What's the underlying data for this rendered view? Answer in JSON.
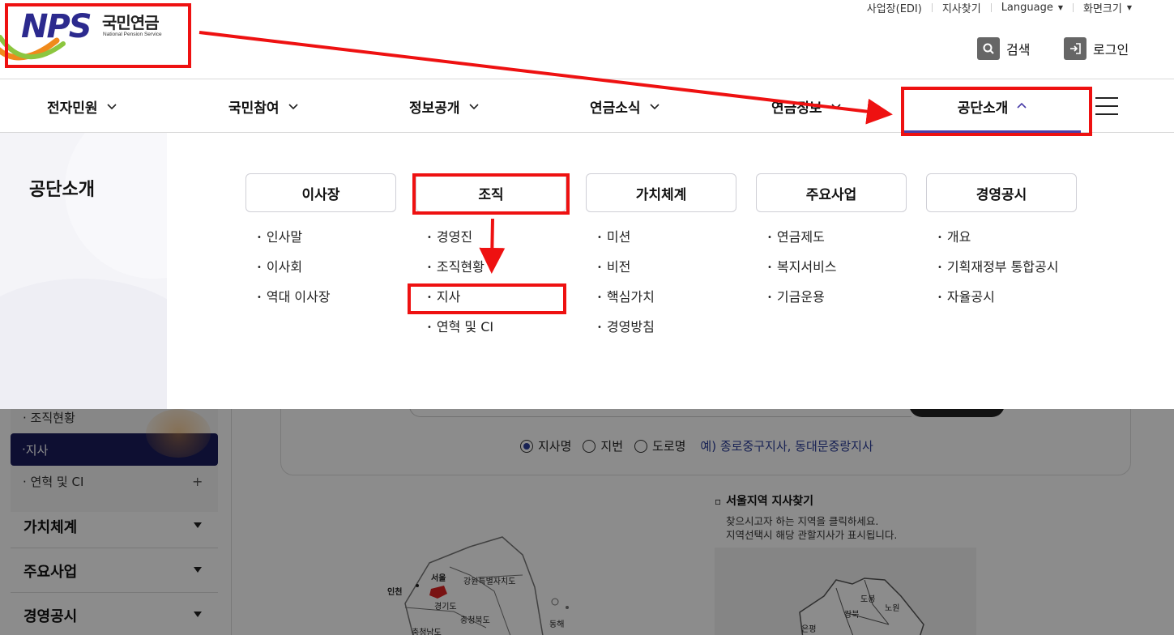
{
  "logo": {
    "text": "NPS",
    "kr": "국민연금",
    "en": "National Pension Service"
  },
  "util": {
    "edi": "사업장(EDI)",
    "branch_find": "지사찾기",
    "language": "Language",
    "screen_size": "화면크기"
  },
  "header_buttons": {
    "search": "검색",
    "login": "로그인"
  },
  "gnb": [
    {
      "label": "전자민원"
    },
    {
      "label": "국민참여"
    },
    {
      "label": "정보공개"
    },
    {
      "label": "연금소식"
    },
    {
      "label": "연금정보"
    },
    {
      "label": "공단소개",
      "active": true
    }
  ],
  "mega": {
    "title": "공단소개",
    "columns": [
      {
        "head": "이사장",
        "items": [
          "인사말",
          "이사회",
          "역대 이사장"
        ]
      },
      {
        "head": "조직",
        "items": [
          "경영진",
          "조직현황",
          "지사",
          "연혁 및 CI"
        ]
      },
      {
        "head": "가치체계",
        "items": [
          "미션",
          "비전",
          "핵심가치",
          "경영방침"
        ]
      },
      {
        "head": "주요사업",
        "items": [
          "연금제도",
          "복지서비스",
          "기금운용"
        ]
      },
      {
        "head": "경영공시",
        "items": [
          "개요",
          "기획재정부 통합공시",
          "자율공시"
        ]
      }
    ]
  },
  "sidebar": {
    "sub_items": [
      "조직현황",
      "지사",
      "연혁 및 CI"
    ],
    "plus": "+",
    "menus": [
      "가치체계",
      "주요사업",
      "경영공시"
    ]
  },
  "search": {
    "options": [
      "지사명",
      "지번",
      "도로명"
    ],
    "selected": "지사명",
    "example": "예) 종로중구지사, 동대문중랑지사"
  },
  "map": {
    "title": "서울지역 지사찾기",
    "desc1": "찾으시고자 하는 지역을 클릭하세요.",
    "desc2": "지역선택시 해당 관할지사가 표시됩니다.",
    "labels": [
      "인천",
      "서울",
      "강원특별자치도",
      "경기도",
      "충청북도",
      "충청남도",
      "동해"
    ],
    "seoul_labels": [
      "도봉",
      "노원",
      "강북",
      "은평"
    ]
  },
  "colors": {
    "brand": "#2c2a8e",
    "sidebar_active": "#1a1d5c",
    "annotation": "#ee1111",
    "link": "#2c3e99"
  }
}
